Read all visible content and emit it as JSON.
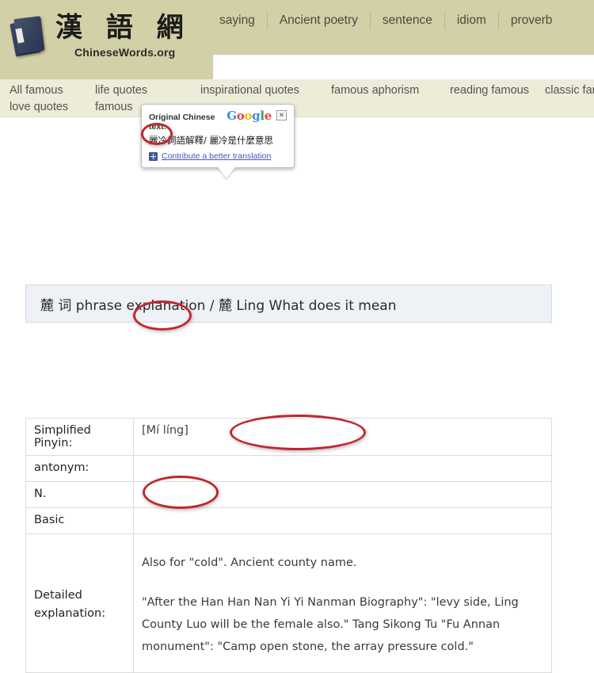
{
  "site": {
    "logo_cn": "漢 語 網",
    "logo_en": "ChineseWords.org",
    "book_icon": "book-icon"
  },
  "top_nav": {
    "items": [
      {
        "label": "saying"
      },
      {
        "label": "Ancient poetry"
      },
      {
        "label": "sentence"
      },
      {
        "label": "idiom"
      },
      {
        "label": "proverb"
      }
    ]
  },
  "search": {
    "value": "",
    "placeholder": ""
  },
  "sub_nav": {
    "columns": [
      {
        "line1": "All famous",
        "line2": "love quotes"
      },
      {
        "line1": "life quotes",
        "line2": "famous"
      },
      {
        "line1": "inspirational quotes",
        "line2": ""
      },
      {
        "line1": "famous aphorism",
        "line2": ""
      },
      {
        "line1": "reading famous",
        "line2": ""
      },
      {
        "line1": "classic fam",
        "line2": ""
      }
    ]
  },
  "google_tooltip": {
    "label": "Original Chinese text:",
    "original_text": "麗冷詞語解釋/ 麗冷是什麼意思",
    "contribute_link": "Contribute a better translation",
    "close_label": "✕",
    "brand": {
      "g1": "G",
      "o1": "o",
      "o2": "o",
      "g2": "g",
      "l": "l",
      "e": "e"
    }
  },
  "page": {
    "title": "麓 词 phrase explanation / 麓 Ling What does it mean"
  },
  "info_table": {
    "rows": [
      {
        "key": "Simplified Pinyin:",
        "value": "[Mí líng]"
      },
      {
        "key": "antonym:",
        "value": ""
      },
      {
        "key": "N.",
        "value": ""
      },
      {
        "key": "Basic",
        "value": ""
      }
    ],
    "detailed": {
      "key_line1": "Detailed",
      "key_line2": "explanation:",
      "paragraphs": [
        "Also for \"cold\". Ancient county name.",
        "\"After the Han Han Nan Yi Yi Nanman Biography\": \"levy side, Ling County Luo will be the female also.\" Tang Sikong Tu \"Fu Annan monument\": \"Camp open stone, the array pressure cold.\""
      ]
    }
  },
  "annotations": {
    "accent_color": "#c1272d",
    "circles": [
      {
        "name": "original-chinese-text"
      },
      {
        "name": "simplified-pinyin-value"
      },
      {
        "name": "ancient-county-name"
      },
      {
        "name": "county-luo"
      }
    ]
  },
  "colors": {
    "header_bg": "#d2d0a6",
    "subnav_bg": "#edecd9",
    "title_bg": "#eef1f5",
    "link": "#4455bb"
  }
}
